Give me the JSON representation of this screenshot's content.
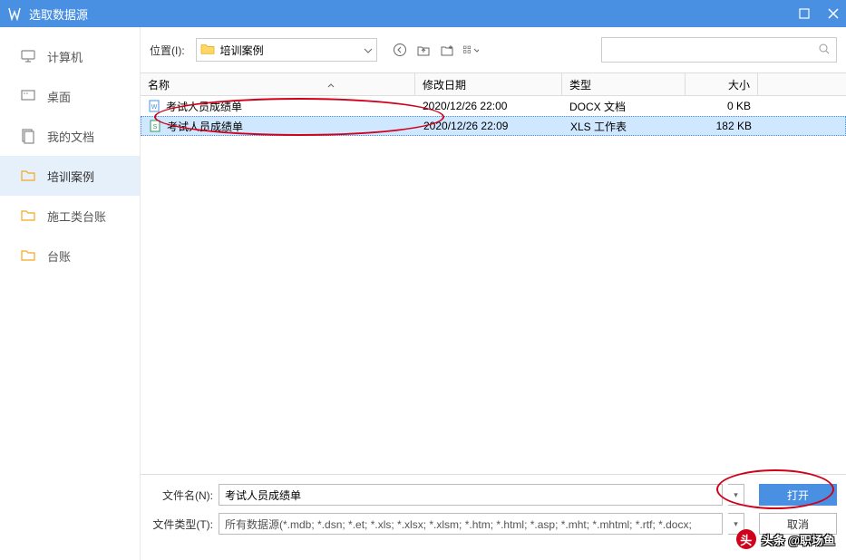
{
  "title": "选取数据源",
  "toolbar": {
    "location_label": "位置(I):",
    "current_path": "培训案例"
  },
  "sidebar": {
    "items": [
      {
        "label": "计算机",
        "icon": "monitor"
      },
      {
        "label": "桌面",
        "icon": "desktop"
      },
      {
        "label": "我的文档",
        "icon": "documents"
      },
      {
        "label": "培训案例",
        "icon": "folder",
        "active": true
      },
      {
        "label": "施工类台账",
        "icon": "folder"
      },
      {
        "label": "台账",
        "icon": "folder"
      }
    ]
  },
  "columns": {
    "name": "名称",
    "date": "修改日期",
    "type": "类型",
    "size": "大小"
  },
  "files": [
    {
      "name": "考试人员成绩单",
      "date": "2020/12/26 22:00",
      "type": "DOCX 文档",
      "size": "0 KB",
      "icon": "docx",
      "selected": false
    },
    {
      "name": "考试人员成绩单",
      "date": "2020/12/26 22:09",
      "type": "XLS 工作表",
      "size": "182 KB",
      "icon": "xls",
      "selected": true
    }
  ],
  "bottom": {
    "filename_label": "文件名(N):",
    "filename_value": "考试人员成绩单",
    "filetype_label": "文件类型(T):",
    "filetype_value": "所有数据源(*.mdb; *.dsn; *.et; *.xls; *.xlsx; *.xlsm; *.htm; *.html; *.asp; *.mht; *.mhtml; *.rtf; *.docx;",
    "open_label": "打开",
    "cancel_label": "取消"
  },
  "watermark": "头条 @职场鱼"
}
